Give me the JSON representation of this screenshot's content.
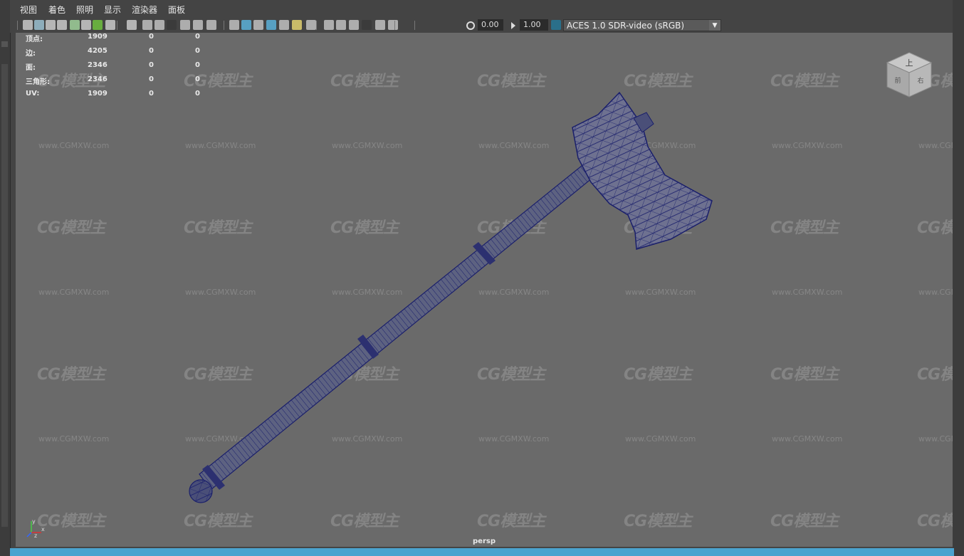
{
  "menu": [
    "视图",
    "着色",
    "照明",
    "显示",
    "渲染器",
    "面板"
  ],
  "toolbar": {
    "exposure_value": "0.00",
    "gamma_value": "1.00",
    "colorspace": "ACES 1.0 SDR-video (sRGB)",
    "icons": [
      "camera-select-icon",
      "camera-attributes-icon",
      "bookmark-icon",
      "image-plane-icon",
      "isolate-icon",
      "pencil-icon",
      "grid-icon",
      "film-gate-icon",
      "resolution-gate-icon",
      "gate-mask-icon",
      "field-chart-icon",
      "safe-action-icon",
      "safe-title-icon",
      "wireframe-icon",
      "smooth-shade-icon",
      "flat-shade-icon",
      "wireframe-on-shaded-icon",
      "textured-icon",
      "lights-icon",
      "shadows-icon",
      "ambient-occlusion-icon",
      "motion-blur-icon",
      "anti-alias-icon",
      "depth-of-field-icon",
      "isolate-select-icon",
      "xray-icon",
      "xray-joints-icon",
      "xray-components-icon",
      "exposure-icon",
      "gamma-icon",
      "color-management-icon"
    ]
  },
  "stats": {
    "rows": [
      {
        "label": "顶点:",
        "a": "1909",
        "b": "0",
        "c": "0"
      },
      {
        "label": "边:",
        "a": "4205",
        "b": "0",
        "c": "0"
      },
      {
        "label": "面:",
        "a": "2346",
        "b": "0",
        "c": "0"
      },
      {
        "label": "三角形:",
        "a": "2346",
        "b": "0",
        "c": "0"
      },
      {
        "label": "UV:",
        "a": "1909",
        "b": "0",
        "c": "0"
      }
    ]
  },
  "viewcube": {
    "top": "上",
    "front": "前",
    "right": "右"
  },
  "camera": "persp",
  "axis": {
    "x": "x",
    "y": "y",
    "z": "z"
  },
  "watermark": {
    "logo": "CG模型主",
    "url": "www.CGMXW.com"
  },
  "colors": {
    "viewport": "#6a6a6a",
    "wire": "#1a1f6b",
    "mesh_fill": "#6a6d88",
    "accent": "#4aa3cf"
  }
}
